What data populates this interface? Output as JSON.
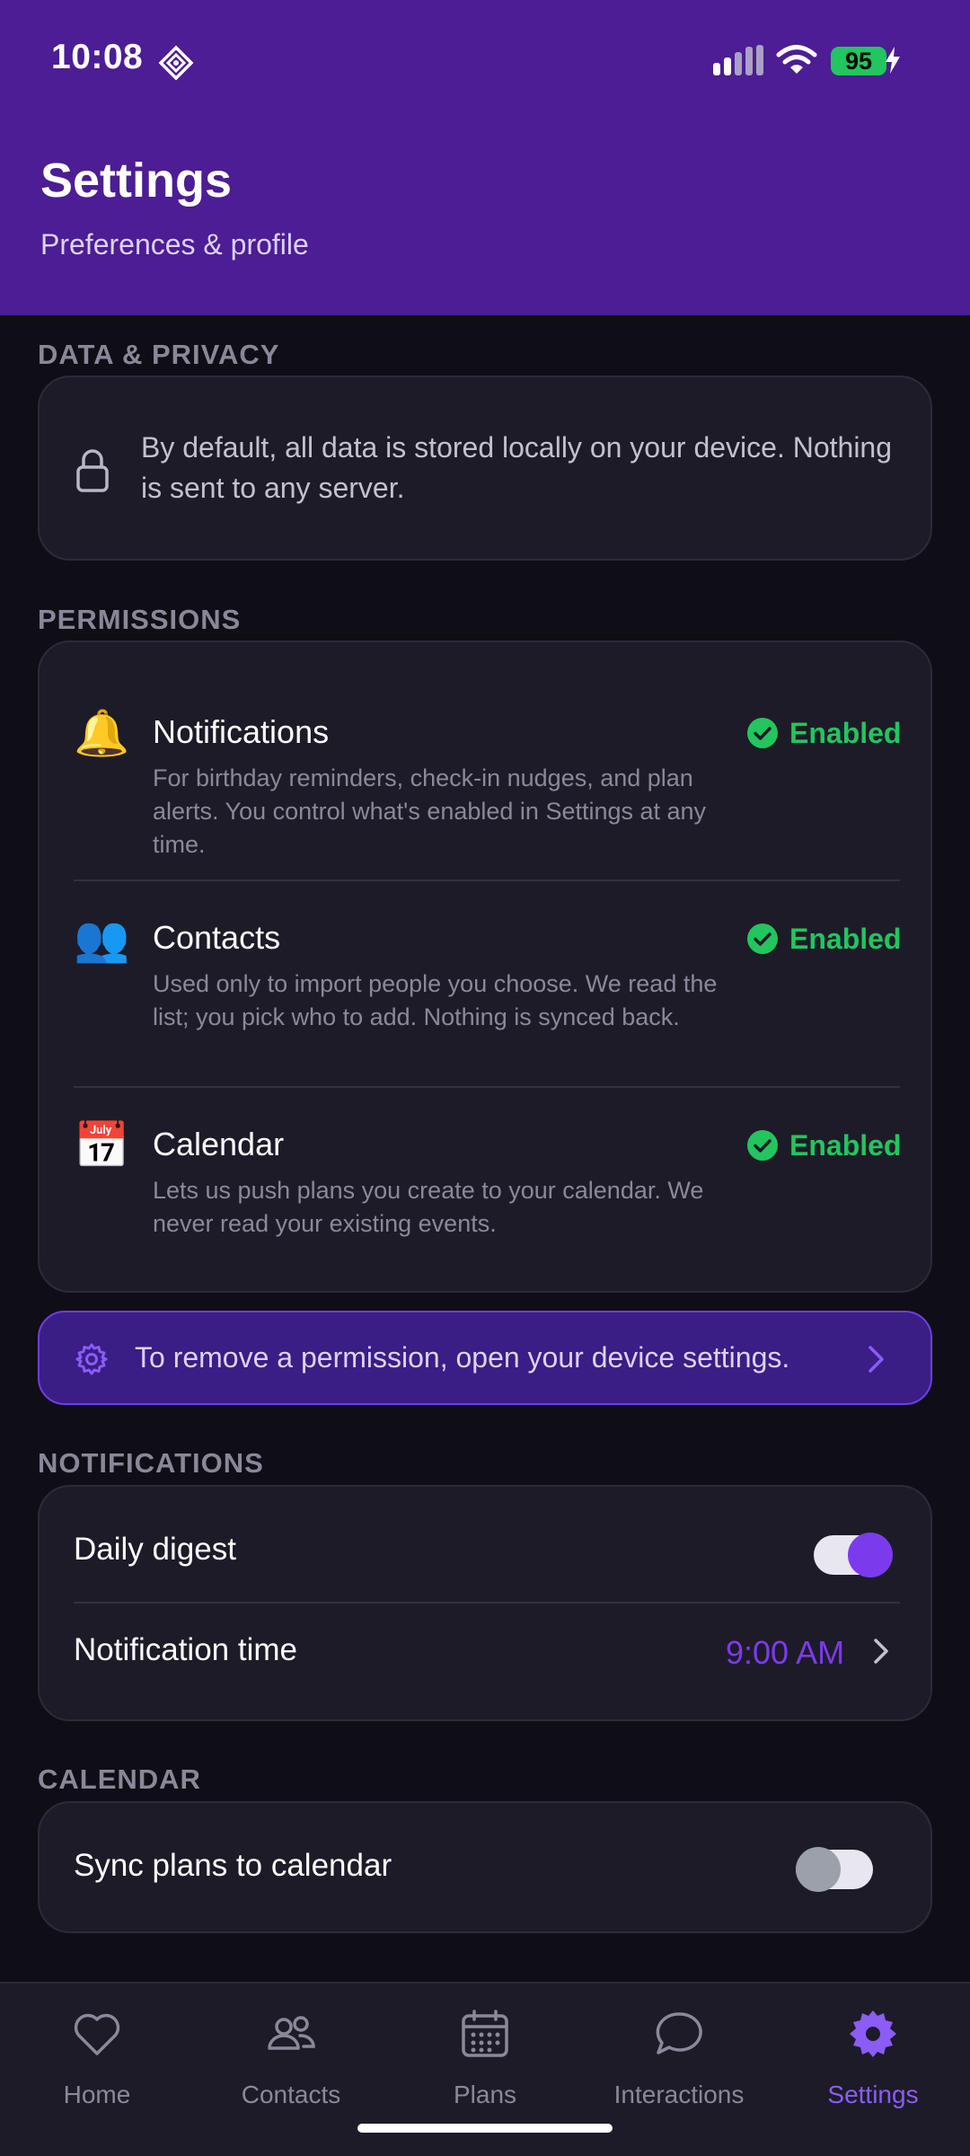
{
  "status_bar": {
    "time": "10:08",
    "battery": "95"
  },
  "header": {
    "title": "Settings",
    "subtitle": "Preferences & profile"
  },
  "data_privacy": {
    "label": "DATA & PRIVACY",
    "text": "By default, all data is stored locally on your device. Nothing is sent to any server."
  },
  "permissions": {
    "label": "PERMISSIONS",
    "items": [
      {
        "emoji": "🔔",
        "title": "Notifications",
        "description": "For birthday reminders, check-in nudges, and plan alerts. You control what's enabled in Settings at any time.",
        "status": "Enabled"
      },
      {
        "emoji": "👥",
        "title": "Contacts",
        "description": "Used only to import people you choose. We read the list; you pick who to add. Nothing is synced back.",
        "status": "Enabled"
      },
      {
        "emoji": "📅",
        "title": "Calendar",
        "description": "Lets us push plans you create to your calendar. We never read your existing events.",
        "status": "Enabled"
      }
    ],
    "banner": "To remove a permission, open your device settings."
  },
  "notifications": {
    "label": "NOTIFICATIONS",
    "daily_digest_label": "Daily digest",
    "daily_digest_on": true,
    "notification_time_label": "Notification time",
    "notification_time_value": "9:00 AM"
  },
  "calendar": {
    "label": "CALENDAR",
    "sync_label": "Sync plans to calendar",
    "sync_on": false
  },
  "tab_bar": {
    "tabs": [
      {
        "label": "Home",
        "icon": "heart-icon",
        "active": false
      },
      {
        "label": "Contacts",
        "icon": "people-icon",
        "active": false
      },
      {
        "label": "Plans",
        "icon": "calendar-icon",
        "active": false
      },
      {
        "label": "Interactions",
        "icon": "chat-bubble-icon",
        "active": false
      },
      {
        "label": "Settings",
        "icon": "gear-icon",
        "active": true
      }
    ]
  },
  "colors": {
    "header": "#4c1d95",
    "accent": "#7c3aed",
    "enabled": "#22c55e",
    "background": "#0f0e16",
    "card": "#1d1b28"
  }
}
